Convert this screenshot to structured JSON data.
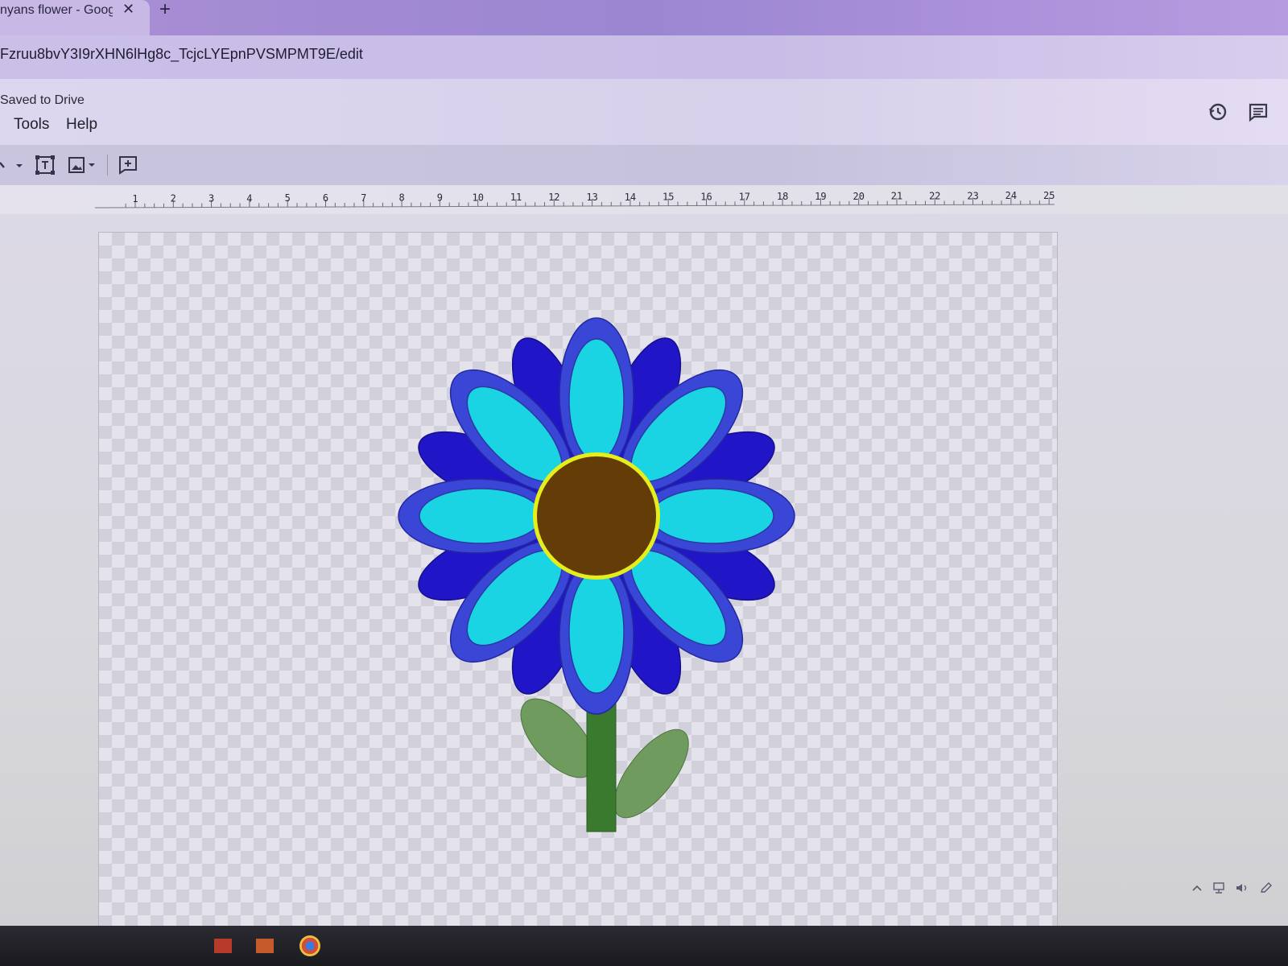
{
  "browser": {
    "tab_title": "nyans flower - Googl",
    "close_glyph": "✕",
    "new_tab_glyph": "+",
    "url": "Fzruu8bvY3I9rXHN6lHg8c_TcjcLYEpnPVSMPMT9E/edit"
  },
  "doc": {
    "status": "Saved to Drive",
    "menus": [
      "Tools",
      "Help"
    ],
    "header_icons": [
      "history-icon",
      "comments-icon"
    ]
  },
  "toolbar": {
    "icons": [
      "select-arrow-icon",
      "text-box-icon",
      "image-icon",
      "add-comment-icon"
    ]
  },
  "ruler": {
    "labels": [
      "1",
      "2",
      "3",
      "4",
      "5",
      "6",
      "7",
      "8",
      "9",
      "10",
      "11",
      "12",
      "13",
      "14",
      "15",
      "16",
      "17",
      "18",
      "19",
      "20",
      "21",
      "22",
      "23",
      "24",
      "25"
    ]
  },
  "drawing": {
    "colors": {
      "outer_petal": "#2016c8",
      "middle_petal": "#3a46d6",
      "inner_petal": "#1ad4e4",
      "center": "#643c08",
      "center_ring": "#e6ee1a",
      "stem": "#3a7a2e",
      "leaf": "#6f9c5e"
    }
  },
  "tray": {
    "icons": [
      "chevron-up-icon",
      "network-icon",
      "volume-icon",
      "pen-icon"
    ]
  }
}
